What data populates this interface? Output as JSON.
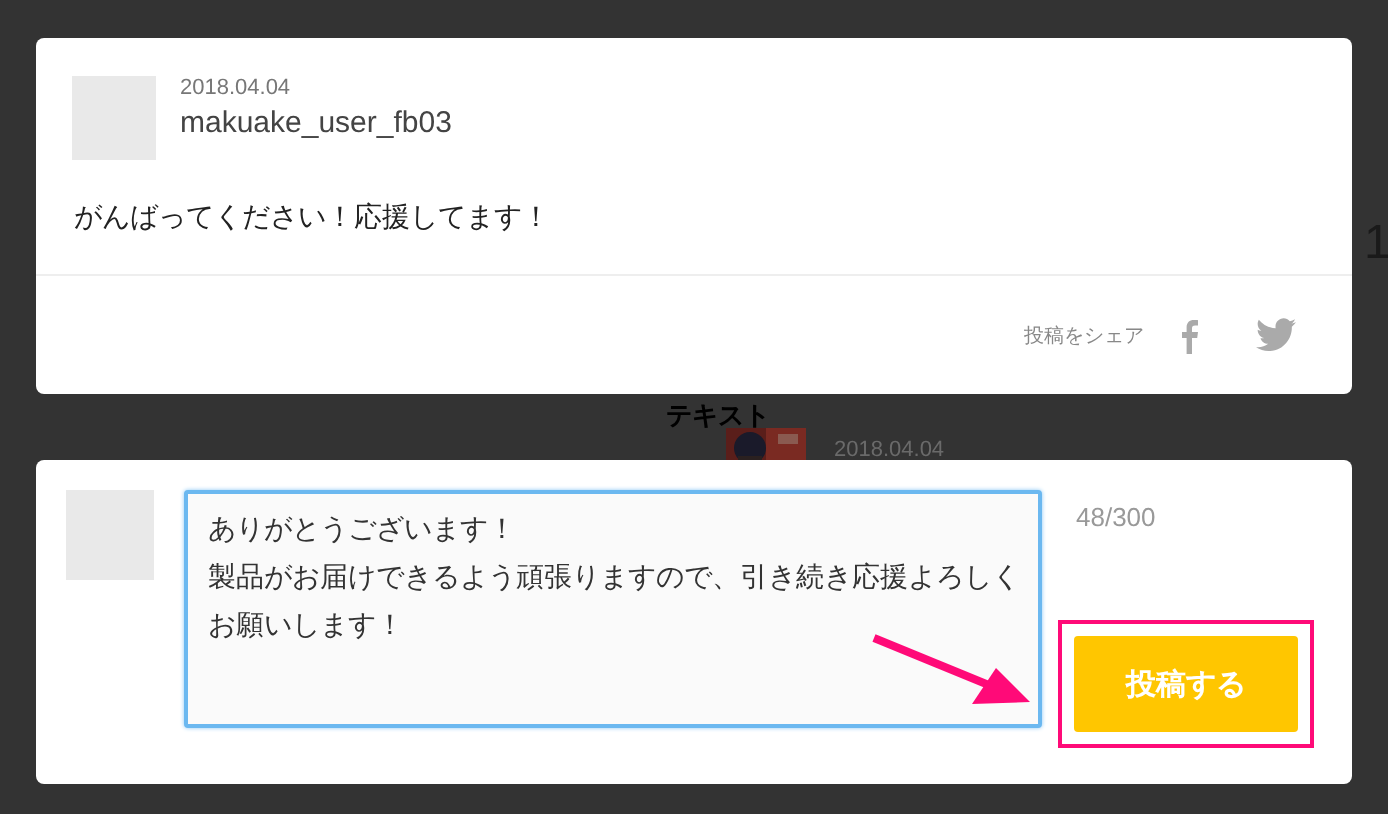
{
  "background_page": {
    "edge_text": "1",
    "section_title": "テキスト",
    "entry_date": "2018.04.04"
  },
  "comment": {
    "date": "2018.04.04",
    "user": "makuake_user_fb03",
    "text": "がんばってください！応援してます！",
    "share_label": "投稿をシェア"
  },
  "reply": {
    "lines": [
      "ありがとうございます！",
      "製品がお届けできるよう頑張りますので、引き続き応援よろしくお願いします！"
    ],
    "count": "48/300",
    "submit": "投稿する",
    "highlighted": true
  }
}
